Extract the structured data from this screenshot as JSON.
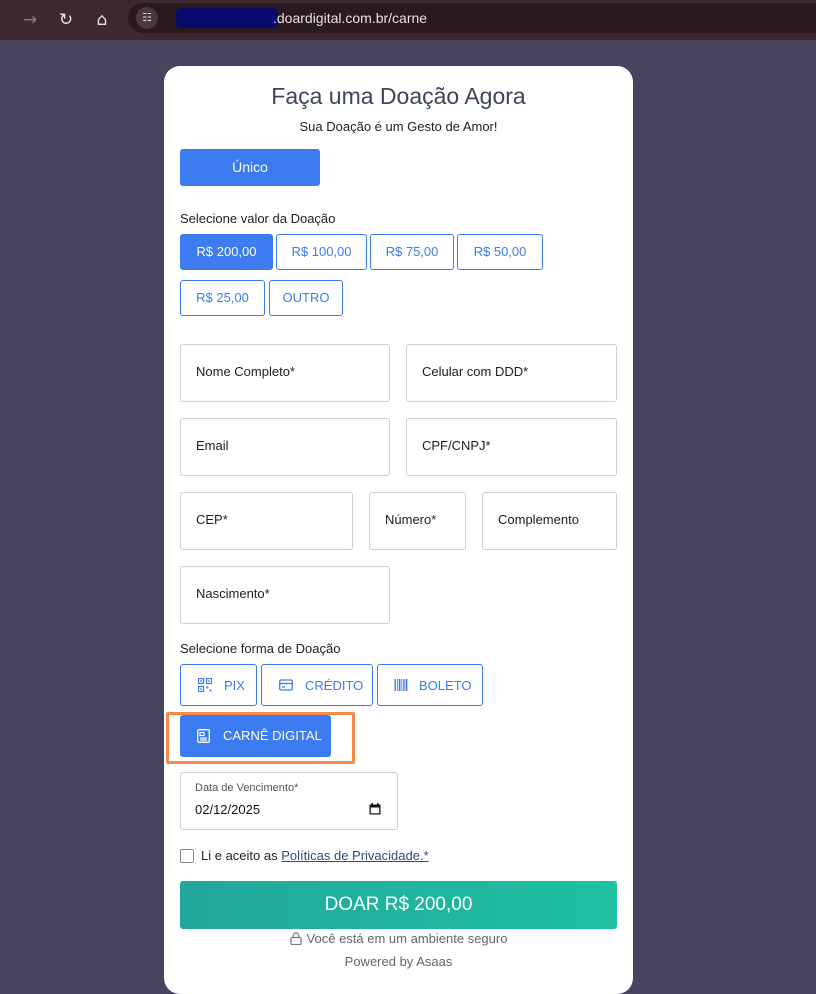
{
  "browser": {
    "back_glyph": "→",
    "reload_glyph": "↻",
    "home_glyph": "⌂",
    "site_info_glyph": "☷",
    "url": ".doardigital.com.br/carne"
  },
  "card": {
    "title": "Faça uma Doação Agora",
    "subtitle": "Sua Doação é um Gesto de Amor!",
    "frequency_button": "Único",
    "amount_section_label": "Selecione valor da Doação",
    "amounts": [
      "R$ 200,00",
      "R$ 100,00",
      "R$ 75,00",
      "R$ 50,00",
      "R$ 25,00",
      "OUTRO"
    ],
    "selected_amount": "R$ 200,00",
    "fields": {
      "nome": "Nome Completo*",
      "celular": "Celular com DDD*",
      "email": "Email",
      "cpf": "CPF/CNPJ*",
      "cep": "CEP*",
      "numero": "Número*",
      "complemento": "Complemento",
      "nascimento": "Nascimento*"
    },
    "payment_section_label": "Selecione forma de Doação",
    "payment_methods": {
      "pix": "PIX",
      "credito": "CRÉDITO",
      "boleto": "BOLETO",
      "carne": "CARNÊ DIGITAL"
    },
    "selected_payment": "CARNÊ DIGITAL",
    "due_date": {
      "label": "Data de Vencimento*",
      "value": "02/12/2025"
    },
    "privacy": {
      "prefix": "Li e aceito as ",
      "link": "Políticas de Privacidade.*",
      "checked": false
    },
    "donate_button": "DOAR R$ 200,00",
    "secure_text": "Você está em um ambiente seguro",
    "powered_by": "Powered by Asaas"
  },
  "colors": {
    "background": "#474460",
    "browser_bar": "#3c2a2e",
    "primary": "#3d7bf0",
    "donate_gradient_start": "#22a79b",
    "donate_gradient_end": "#1ec0a0",
    "highlight": "#f58a4b"
  },
  "icons": [
    "back-arrow-icon",
    "reload-icon",
    "home-icon",
    "site-info-icon",
    "qr-code-icon",
    "credit-card-icon",
    "barcode-icon",
    "document-icon",
    "calendar-icon",
    "lock-icon"
  ]
}
